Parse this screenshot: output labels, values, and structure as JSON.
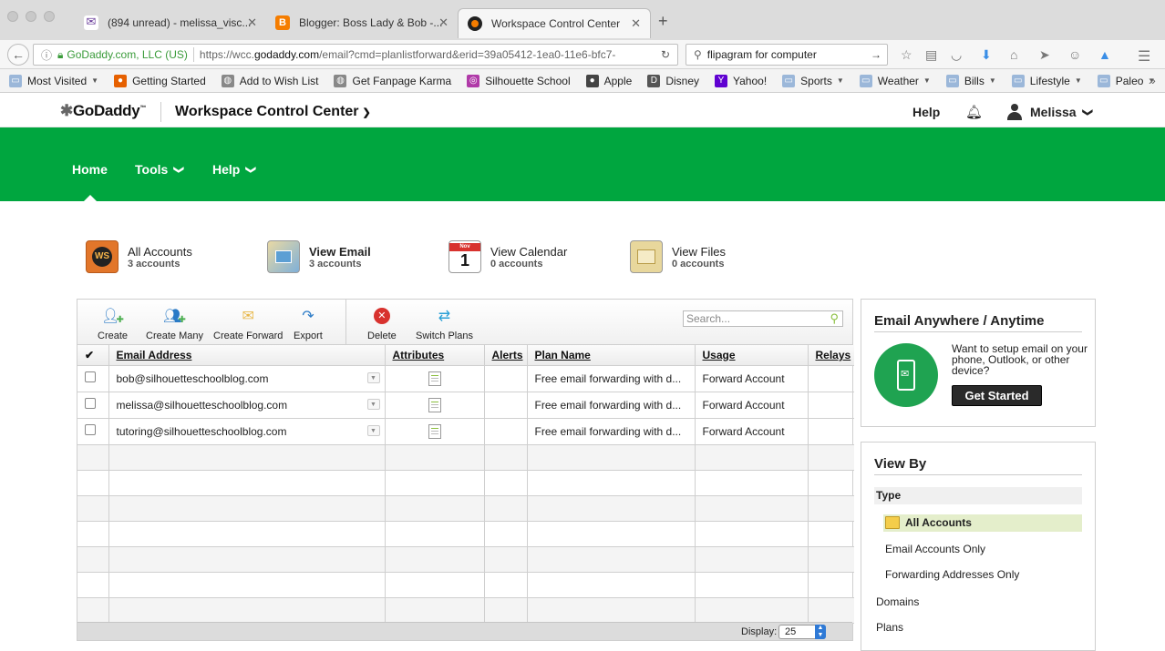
{
  "browser": {
    "tabs": [
      {
        "label": "(894 unread) - melissa_visc...",
        "color": "#6a3d9a"
      },
      {
        "label": "Blogger: Boss Lady & Bob -...",
        "color": "#f57d00"
      },
      {
        "label": "Workspace Control Center",
        "color": "#333"
      }
    ],
    "new_tab": "+",
    "url": {
      "org": "GoDaddy.com, LLC (US)",
      "prefix": "https://wcc.",
      "domain": "godaddy.com",
      "path": "/email?cmd=planlistforward&erid=39a05412-1ea0-11e6-bfc7-"
    },
    "search_text": "flipagram for computer",
    "bookmarks": [
      {
        "label": "Most Visited",
        "dropdown": true,
        "icon": "folder-icon"
      },
      {
        "label": "Getting Started",
        "dropdown": false,
        "icon": "firefox-icon"
      },
      {
        "label": "Add to Wish List",
        "dropdown": false,
        "icon": "globe-icon"
      },
      {
        "label": "Get Fanpage Karma",
        "dropdown": false,
        "icon": "globe-icon"
      },
      {
        "label": "Silhouette School",
        "dropdown": false,
        "icon": "silhouette-icon"
      },
      {
        "label": "Apple",
        "dropdown": false,
        "icon": "apple-icon"
      },
      {
        "label": "Disney",
        "dropdown": false,
        "icon": "disney-icon"
      },
      {
        "label": "Yahoo!",
        "dropdown": false,
        "icon": "yahoo-icon"
      },
      {
        "label": "Sports",
        "dropdown": true,
        "icon": "folder-icon"
      },
      {
        "label": "Weather",
        "dropdown": true,
        "icon": "folder-icon"
      },
      {
        "label": "Bills",
        "dropdown": true,
        "icon": "folder-icon"
      },
      {
        "label": "Lifestyle",
        "dropdown": true,
        "icon": "folder-icon"
      },
      {
        "label": "Paleo",
        "dropdown": true,
        "icon": "folder-icon"
      }
    ]
  },
  "header": {
    "logo": "GoDaddy",
    "trademark": "™",
    "app_name": "Workspace Control Center",
    "help": "Help",
    "user": "Melissa"
  },
  "nav": {
    "home": "Home",
    "tools": "Tools",
    "help": "Help"
  },
  "tiles": [
    {
      "title": "All Accounts",
      "sub": "3 accounts",
      "bold": false
    },
    {
      "title": "View Email",
      "sub": "3 accounts",
      "bold": true
    },
    {
      "title": "View Calendar",
      "sub": "0 accounts",
      "bold": false
    },
    {
      "title": "View Files",
      "sub": "0 accounts",
      "bold": false
    }
  ],
  "tile_icons": {
    "ws": "WS",
    "calendar_month": "Nov",
    "calendar_day": "1"
  },
  "toolbar": {
    "create": "Create",
    "create_many": "Create Many",
    "create_forward": "Create Forward",
    "export": "Export",
    "delete": "Delete",
    "switch_plans": "Switch Plans",
    "search_placeholder": "Search..."
  },
  "table": {
    "columns": [
      "Email Address",
      "Attributes",
      "Alerts",
      "Plan Name",
      "Usage",
      "Relays"
    ],
    "rows": [
      {
        "email": "bob@silhouetteschoolblog.com",
        "plan": "Free email forwarding with d...",
        "usage": "Forward Account"
      },
      {
        "email": "melissa@silhouetteschoolblog.com",
        "plan": "Free email forwarding with d...",
        "usage": "Forward Account"
      },
      {
        "email": "tutoring@silhouetteschoolblog.com",
        "plan": "Free email forwarding with d...",
        "usage": "Forward Account"
      }
    ],
    "display_label": "Display:",
    "display_value": "25"
  },
  "promo": {
    "title": "Email Anywhere / Anytime",
    "text": "Want to setup email on your phone, Outlook, or other device?",
    "button": "Get Started"
  },
  "view_by": {
    "title": "View By",
    "type_label": "Type",
    "items": [
      "All Accounts",
      "Email Accounts Only",
      "Forwarding Addresses Only"
    ],
    "domains": "Domains",
    "plans": "Plans"
  },
  "colors": {
    "brand_green": "#00a63f",
    "url_green": "#3a9b3a"
  }
}
